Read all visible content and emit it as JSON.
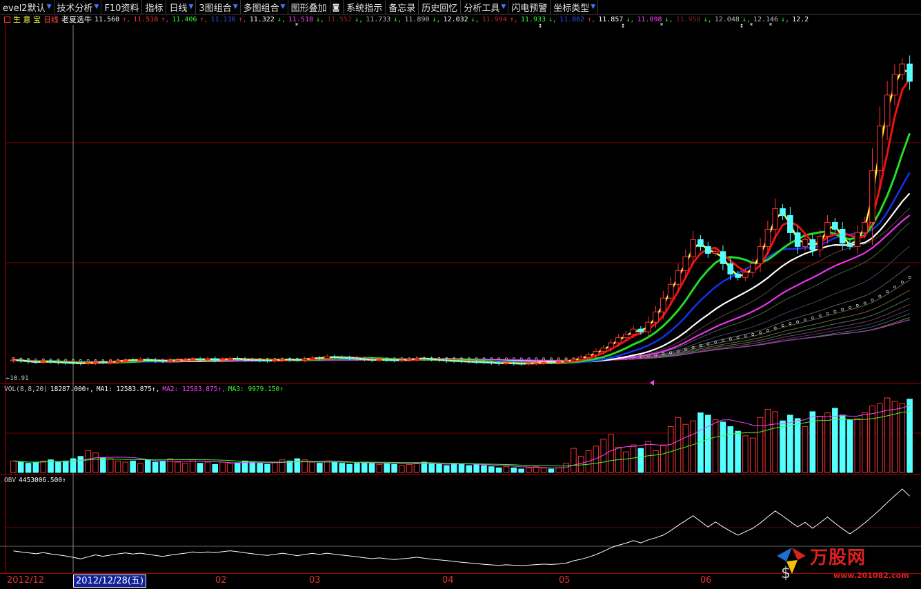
{
  "toolbar": {
    "items": [
      {
        "label": "evel2默认",
        "arrow": "▼"
      },
      {
        "label": "技术分析",
        "arrow": "▼"
      },
      {
        "label": "F10资料",
        "arrow": ""
      },
      {
        "label": "指标",
        "arrow": ""
      },
      {
        "label": "日线",
        "arrow": "▼"
      },
      {
        "label": "3图组合",
        "arrow": "▼"
      },
      {
        "label": "多图组合",
        "arrow": "▼"
      },
      {
        "label": "图形叠加",
        "arrow": ""
      },
      {
        "label": "系统指示",
        "arrow": ""
      },
      {
        "label": "备忘录",
        "arrow": ""
      },
      {
        "label": "历史回忆",
        "arrow": ""
      },
      {
        "label": "分析工具",
        "arrow": "▼"
      },
      {
        "label": "闪电预警",
        "arrow": ""
      },
      {
        "label": "坐标类型",
        "arrow": "▼"
      }
    ],
    "icons": {
      "camera": "camera-icon"
    }
  },
  "infoline": {
    "stock_name": "生 意 宝",
    "period": "日线",
    "indicator": "老夏选牛",
    "values": [
      {
        "text": "11.560",
        "color": "#ffffff"
      },
      {
        "text": "↑,",
        "color": "#ff3333"
      },
      {
        "text": "11.518",
        "color": "#ff3333"
      },
      {
        "text": "↑,",
        "color": "#ff3333"
      },
      {
        "text": "11.406",
        "color": "#33ff33"
      },
      {
        "text": "↑,",
        "color": "#ff3333"
      },
      {
        "text": "11.136",
        "color": "#3355ff"
      },
      {
        "text": "↑,",
        "color": "#ff3333"
      },
      {
        "text": "11.322",
        "color": "#ffffff"
      },
      {
        "text": "↓,",
        "color": "#33ff33"
      },
      {
        "text": "11.518",
        "color": "#ff44ff"
      },
      {
        "text": "↓,",
        "color": "#33ff33"
      },
      {
        "text": "11.552",
        "color": "#882222"
      },
      {
        "text": "↓,",
        "color": "#33ff33"
      },
      {
        "text": "11.733",
        "color": "#bbbbbb"
      },
      {
        "text": "↓,",
        "color": "#33ff33"
      },
      {
        "text": "11.890",
        "color": "#bbbbbb"
      },
      {
        "text": "↓,",
        "color": "#33ff33"
      },
      {
        "text": "12.032",
        "color": "#ffffff"
      },
      {
        "text": "↓,",
        "color": "#33ff33"
      },
      {
        "text": "11.994",
        "color": "#cc2222"
      },
      {
        "text": "↑,",
        "color": "#ff3333"
      },
      {
        "text": "11.933",
        "color": "#33ff33"
      },
      {
        "text": "↓,",
        "color": "#33ff33"
      },
      {
        "text": "11.862",
        "color": "#3355ff"
      },
      {
        "text": "↑,",
        "color": "#ff3333"
      },
      {
        "text": "11.857",
        "color": "#ffffff"
      },
      {
        "text": "↓,",
        "color": "#33ff33"
      },
      {
        "text": "11.898",
        "color": "#ff44ff"
      },
      {
        "text": "↓,",
        "color": "#33ff33"
      },
      {
        "text": "11.958",
        "color": "#882222"
      },
      {
        "text": "↓,",
        "color": "#33ff33"
      },
      {
        "text": "12.048",
        "color": "#bbbbbb"
      },
      {
        "text": "↓,",
        "color": "#33ff33"
      },
      {
        "text": "12.146",
        "color": "#bbbbbb"
      },
      {
        "text": "↓,",
        "color": "#33ff33"
      },
      {
        "text": "12.2",
        "color": "#ffffff"
      }
    ]
  },
  "price_panel": {
    "current_price_label": "←10.91"
  },
  "volume_panel": {
    "legend": [
      {
        "text": "VOL(8,8,20)",
        "color": "#cccccc"
      },
      {
        "text": "18287.000↑,",
        "color": "#ffffff"
      },
      {
        "text": "MA1: 12583.875↑,",
        "color": "#ffffff"
      },
      {
        "text": "MA2: 12583.875↑,",
        "color": "#ff44ff"
      },
      {
        "text": "MA3: 9979.150↑",
        "color": "#33ff33"
      }
    ]
  },
  "obv_panel": {
    "legend": [
      {
        "text": "OBV",
        "color": "#cccccc"
      },
      {
        "text": "4453006.500↑",
        "color": "#ffffff"
      }
    ]
  },
  "date_axis": {
    "labels": [
      {
        "text": "2012/12",
        "month": "2012/12"
      },
      {
        "text": "02",
        "month": "02"
      },
      {
        "text": "03",
        "month": "03"
      },
      {
        "text": "04",
        "month": "04"
      },
      {
        "text": "05",
        "month": "05"
      },
      {
        "text": "06",
        "month": "06"
      }
    ],
    "cursor_date": "2012/12/28(五)"
  },
  "watermark": {
    "brand": "万股网",
    "url": "www.201082.com"
  },
  "colors": {
    "up": "#ff3333",
    "down": "#54ffff",
    "grid": "#7a0000",
    "ma_fast": "#ffff33",
    "ma_red": "#ee1111",
    "ma_green": "#22dd22",
    "ma_blue": "#1133ee",
    "ma_white": "#ffffff",
    "ma_magenta": "#ee33ee"
  },
  "chart_data": {
    "type": "candlestick",
    "title": "生 意 宝 日线 老夏选牛",
    "x_start": "2012/12",
    "x_end": "06",
    "close": [
      9.8,
      9.78,
      9.75,
      9.74,
      9.76,
      9.75,
      9.73,
      9.72,
      9.71,
      9.7,
      9.72,
      9.74,
      9.73,
      9.75,
      9.78,
      9.8,
      9.79,
      9.82,
      9.8,
      9.78,
      9.77,
      9.79,
      9.8,
      9.82,
      9.83,
      9.81,
      9.84,
      9.8,
      9.82,
      9.85,
      9.83,
      9.81,
      9.8,
      9.79,
      9.78,
      9.8,
      9.82,
      9.81,
      9.8,
      9.83,
      9.86,
      9.85,
      9.9,
      9.88,
      9.87,
      9.86,
      9.84,
      9.82,
      9.8,
      9.81,
      9.8,
      9.79,
      9.8,
      9.82,
      9.85,
      9.84,
      9.82,
      9.8,
      9.78,
      9.77,
      9.76,
      9.75,
      9.74,
      9.73,
      9.72,
      9.7,
      9.71,
      9.7,
      9.69,
      9.7,
      9.72,
      9.74,
      9.73,
      9.75,
      9.78,
      9.82,
      9.88,
      9.95,
      10.05,
      10.15,
      10.3,
      10.45,
      10.55,
      10.7,
      10.62,
      10.9,
      11.2,
      11.6,
      12.0,
      12.4,
      12.8,
      13.3,
      13.1,
      12.9,
      12.95,
      12.6,
      12.3,
      12.2,
      12.35,
      12.6,
      13.1,
      13.6,
      14.2,
      14.0,
      13.5,
      13.1,
      13.3,
      13.0,
      13.4,
      13.8,
      13.6,
      13.2,
      13.1,
      13.5,
      13.8,
      15.3,
      16.6,
      17.5,
      18.1,
      18.4,
      17.9
    ],
    "open": [
      9.78,
      9.8,
      9.77,
      9.75,
      9.74,
      9.76,
      9.75,
      9.73,
      9.72,
      9.71,
      9.7,
      9.72,
      9.74,
      9.73,
      9.75,
      9.78,
      9.8,
      9.79,
      9.82,
      9.8,
      9.78,
      9.77,
      9.79,
      9.8,
      9.82,
      9.83,
      9.81,
      9.84,
      9.8,
      9.82,
      9.85,
      9.83,
      9.81,
      9.8,
      9.79,
      9.78,
      9.8,
      9.82,
      9.81,
      9.8,
      9.83,
      9.86,
      9.85,
      9.9,
      9.88,
      9.87,
      9.86,
      9.84,
      9.82,
      9.8,
      9.81,
      9.8,
      9.79,
      9.8,
      9.82,
      9.85,
      9.84,
      9.82,
      9.8,
      9.78,
      9.77,
      9.76,
      9.75,
      9.74,
      9.73,
      9.72,
      9.7,
      9.71,
      9.7,
      9.69,
      9.7,
      9.72,
      9.74,
      9.73,
      9.75,
      9.78,
      9.82,
      9.88,
      9.95,
      10.05,
      10.15,
      10.3,
      10.45,
      10.55,
      10.7,
      10.62,
      10.9,
      11.2,
      11.6,
      12.0,
      12.4,
      12.8,
      13.3,
      13.1,
      12.9,
      12.95,
      12.6,
      12.3,
      12.2,
      12.35,
      12.6,
      13.1,
      13.6,
      14.2,
      14.0,
      13.5,
      13.1,
      13.3,
      13.0,
      13.4,
      13.8,
      13.6,
      13.2,
      13.1,
      13.5,
      13.8,
      15.3,
      16.6,
      17.5,
      18.1,
      18.4
    ],
    "volume": [
      10,
      9,
      8,
      9,
      10,
      11,
      9,
      10,
      12,
      14,
      19,
      17,
      13,
      12,
      10,
      9,
      10,
      8,
      11,
      9,
      10,
      12,
      9,
      8,
      11,
      8,
      9,
      7,
      9,
      8,
      8,
      10,
      9,
      8,
      7,
      9,
      11,
      10,
      12,
      11,
      9,
      8,
      10,
      9,
      8,
      7,
      8,
      9,
      8,
      7,
      8,
      7,
      6,
      7,
      8,
      9,
      8,
      7,
      6,
      8,
      7,
      6,
      7,
      6,
      5,
      4,
      5,
      4,
      3,
      4,
      5,
      4,
      3,
      4,
      8,
      21,
      14,
      19,
      23,
      29,
      33,
      22,
      18,
      24,
      21,
      27,
      19,
      24,
      40,
      48,
      42,
      45,
      52,
      50,
      46,
      44,
      40,
      36,
      32,
      30,
      48,
      55,
      53,
      45,
      50,
      47,
      40,
      53,
      49,
      52,
      56,
      50,
      46,
      47,
      52,
      58,
      60,
      65,
      62,
      60,
      64
    ],
    "obv_trend": "rising"
  }
}
